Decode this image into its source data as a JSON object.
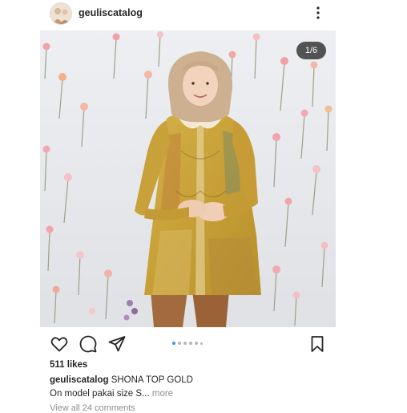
{
  "post": {
    "username": "geuliscatalog",
    "photo_counter": "1/6",
    "likes": "511 likes",
    "caption_username": "geuliscatalog",
    "caption_text": "SHONA TOP GOLD",
    "caption_line2": "On model pakai size S...",
    "more_label": "more",
    "carousel": {
      "total": 6,
      "active_index": 0
    },
    "comments_preview": "View all 24 comments"
  },
  "icons": {
    "more": "more-vertical-icon",
    "like": "heart-icon",
    "comment": "comment-icon",
    "share": "share-icon",
    "save": "bookmark-icon"
  },
  "colors": {
    "text": "#262626",
    "muted": "#8e8e8e",
    "carousel_active": "#3897f0",
    "blouse_gold": "#c9a63a",
    "pants_brown": "#a36a3e",
    "hijab": "#cdb08f",
    "wall": "#e9eaee"
  }
}
